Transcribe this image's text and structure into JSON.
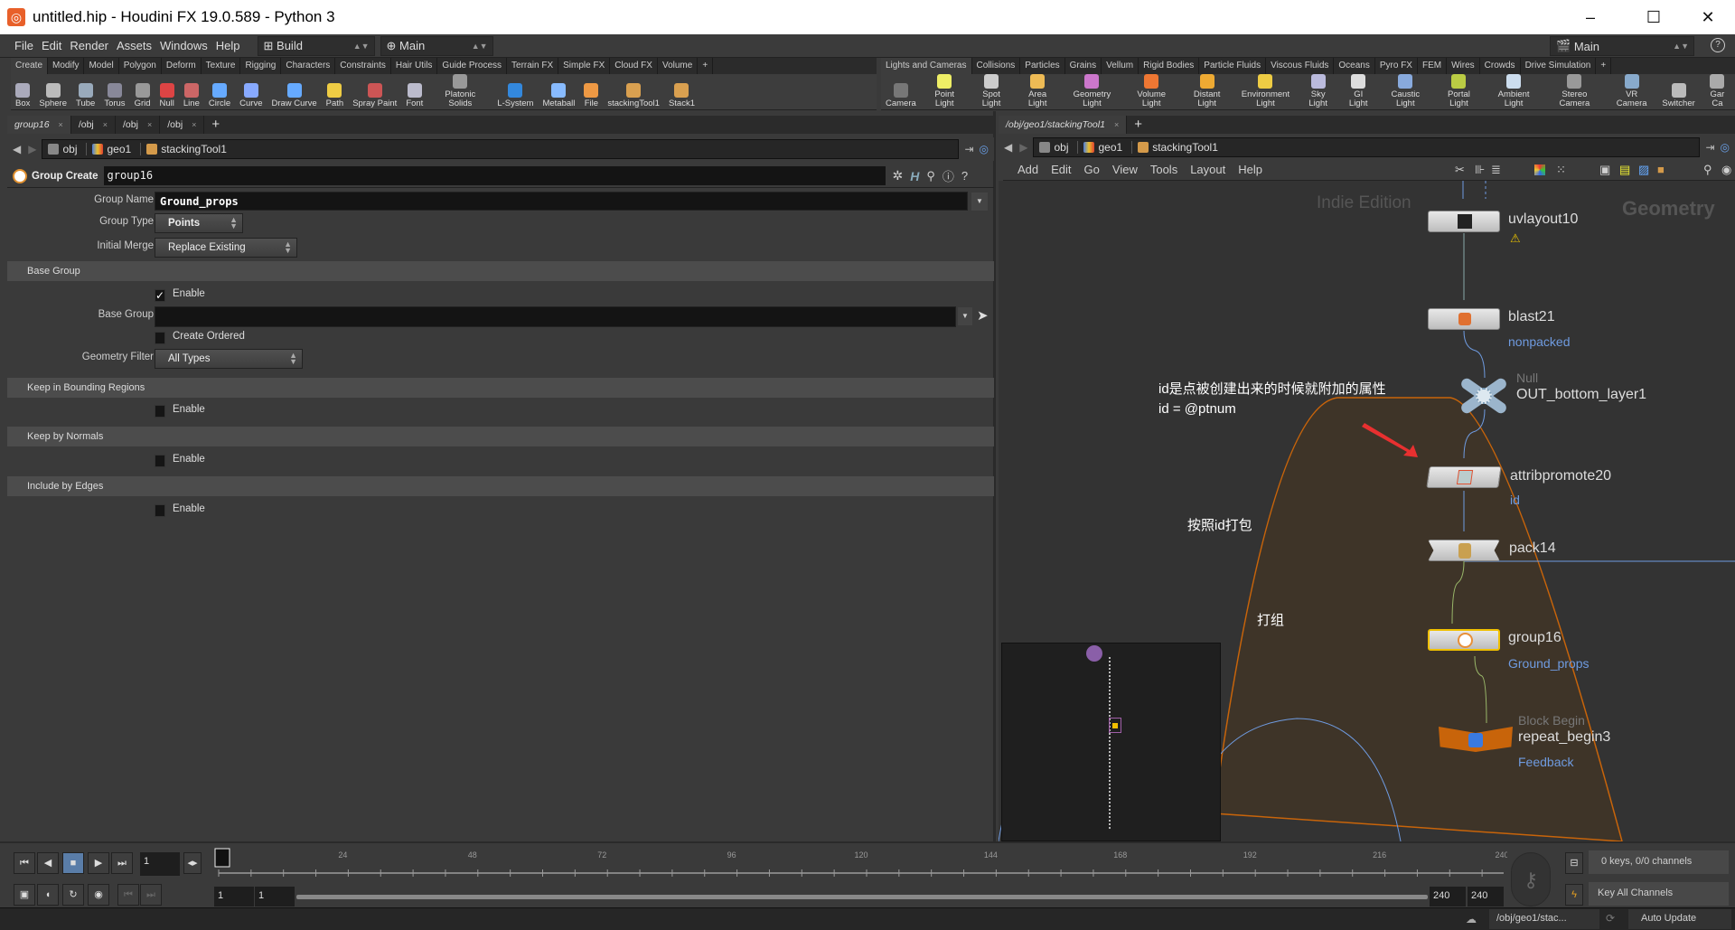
{
  "window": {
    "title": "untitled.hip - Houdini FX 19.0.589 - Python 3",
    "minimize": "–",
    "maximize": "☐",
    "close": "✕"
  },
  "menubar": {
    "items": [
      "File",
      "Edit",
      "Render",
      "Assets",
      "Windows",
      "Help"
    ],
    "desktop": "Build",
    "context": "Main",
    "right_context": "Main",
    "help": "?"
  },
  "shelf_left": {
    "tabs": [
      "Create",
      "Modify",
      "Model",
      "Polygon",
      "Deform",
      "Texture",
      "Rigging",
      "Characters",
      "Constraints",
      "Hair Utils",
      "Guide Process",
      "Terrain FX",
      "Simple FX",
      "Cloud FX",
      "Volume",
      "+"
    ],
    "tools": [
      "Box",
      "Sphere",
      "Tube",
      "Torus",
      "Grid",
      "Null",
      "Line",
      "Circle",
      "Curve",
      "Draw Curve",
      "Path",
      "Spray Paint",
      "Font",
      "Platonic Solids",
      "L-System",
      "Metaball",
      "File",
      "stackingTool1",
      "Stack1"
    ]
  },
  "shelf_right": {
    "tabs": [
      "Lights and Cameras",
      "Collisions",
      "Particles",
      "Grains",
      "Vellum",
      "Rigid Bodies",
      "Particle Fluids",
      "Viscous Fluids",
      "Oceans",
      "Pyro FX",
      "FEM",
      "Wires",
      "Crowds",
      "Drive Simulation",
      "+"
    ],
    "tools": [
      "Camera",
      "Point Light",
      "Spot Light",
      "Area Light",
      "Geometry Light",
      "Volume Light",
      "Distant Light",
      "Environment Light",
      "Sky Light",
      "GI Light",
      "Caustic Light",
      "Portal Light",
      "Ambient Light",
      "Stereo Camera",
      "VR Camera",
      "Switcher",
      "Gar Ca"
    ]
  },
  "left_pane": {
    "tabs": [
      "group16",
      "/obj",
      "/obj",
      "/obj",
      "+"
    ],
    "path": [
      "obj",
      "geo1",
      "stackingTool1"
    ]
  },
  "params": {
    "node_type": "Group Create",
    "node_name": "group16",
    "group_name_label": "Group Name",
    "group_name": "Ground_props",
    "group_type_label": "Group Type",
    "group_type": "Points",
    "initial_merge_label": "Initial Merge",
    "initial_merge": "Replace Existing",
    "base_group_section": "Base Group",
    "enable": "Enable",
    "base_group_enabled": true,
    "base_group_label": "Base Group",
    "base_group": "",
    "create_ordered": "Create Ordered",
    "geometry_filter_label": "Geometry Filter",
    "geometry_filter": "All Types",
    "bounding_section": "Keep in Bounding Regions",
    "normals_section": "Keep by Normals",
    "edges_section": "Include by Edges"
  },
  "network": {
    "tab": "/obj/geo1/stackingTool1",
    "path": [
      "obj",
      "geo1",
      "stackingTool1"
    ],
    "menu": [
      "Add",
      "Edit",
      "Go",
      "View",
      "Tools",
      "Layout",
      "Help"
    ],
    "watermark": "Indie Edition",
    "context_label": "Geometry",
    "nodes": [
      {
        "name": "uvlayout10",
        "comment": "",
        "type": ""
      },
      {
        "name": "blast21",
        "comment": "nonpacked",
        "type": ""
      },
      {
        "name": "OUT_bottom_layer1",
        "comment": "",
        "type": "Null"
      },
      {
        "name": "attribpromote20",
        "comment": "id",
        "type": ""
      },
      {
        "name": "pack14",
        "comment": "",
        "type": ""
      },
      {
        "name": "group16",
        "comment": "Ground_props",
        "type": ""
      },
      {
        "name": "repeat_begin3",
        "comment": "Feedback",
        "type": "Block Begin"
      }
    ],
    "notes": [
      "id是点被创建出来的时候就附加的属性",
      "id = @ptnum",
      "按照id打包",
      "打组"
    ],
    "colors": {
      "wire": "#6f9be0",
      "selected": "#f0c000",
      "block": "#c8640a",
      "arrow": "#e83030"
    }
  },
  "timeline": {
    "current_frame": "1",
    "start": "1",
    "start2": "1",
    "end": "240",
    "end2": "240",
    "ticks": [
      24,
      48,
      72,
      96,
      120,
      144,
      168,
      192,
      216,
      240
    ],
    "range": [
      1,
      240
    ],
    "keys": "0 keys, 0/0 channels",
    "key_mode": "Key All Channels"
  },
  "status": {
    "path": "/obj/geo1/stac...",
    "update": "Auto Update"
  }
}
